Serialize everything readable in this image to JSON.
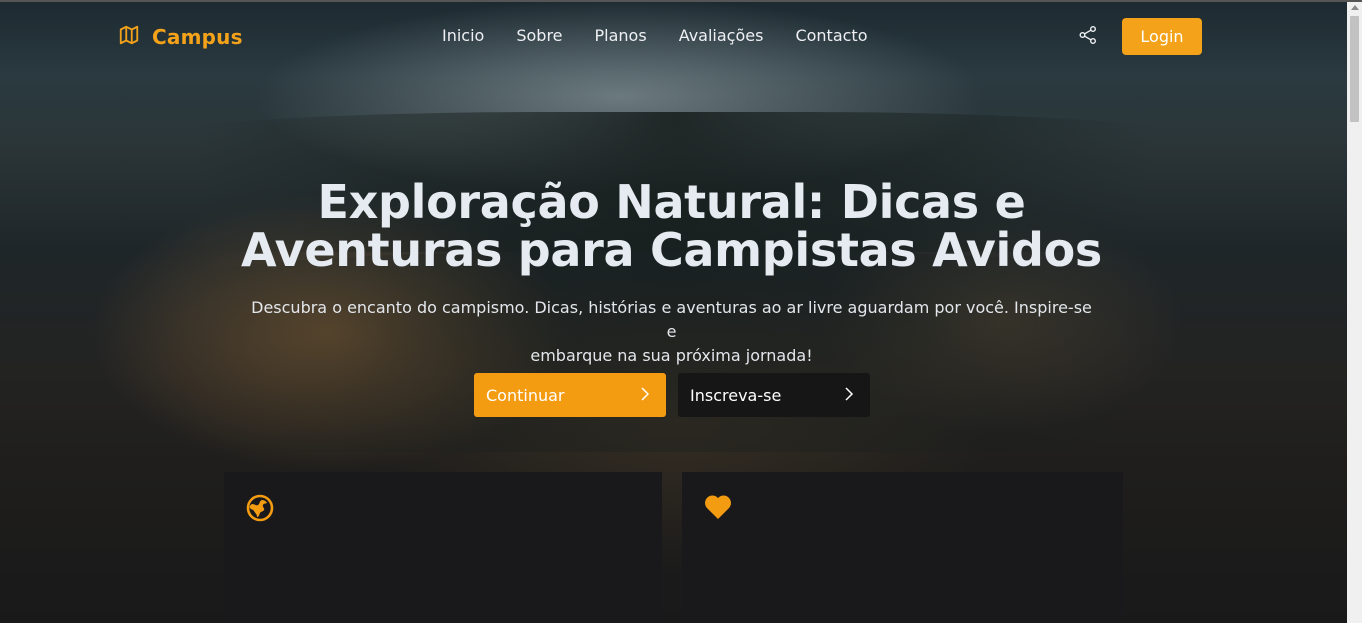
{
  "nav": {
    "brand": "Campus",
    "brand_icon": "map-icon",
    "items": [
      "Inicio",
      "Sobre",
      "Planos",
      "Avaliações",
      "Contacto"
    ],
    "share_icon": "share-icon",
    "login_label": "Login"
  },
  "hero": {
    "title_line1": "Exploração Natural: Dicas e",
    "title_line2": "Aventuras para Campistas Avidos",
    "subtitle_line1": "Descubra o encanto do campismo. Dicas, histórias e aventuras ao ar livre aguardam por você. Inspire-se e",
    "subtitle_line2": "embarque na sua próxima jornada!",
    "primary_button": "Continuar",
    "secondary_button": "Inscreva-se"
  },
  "cards": [
    {
      "icon": "globe-icon"
    },
    {
      "icon": "heart-icon"
    }
  ],
  "colors": {
    "accent": "#f49c11",
    "dark_button": "#161616",
    "card_bg": "#19191b"
  }
}
